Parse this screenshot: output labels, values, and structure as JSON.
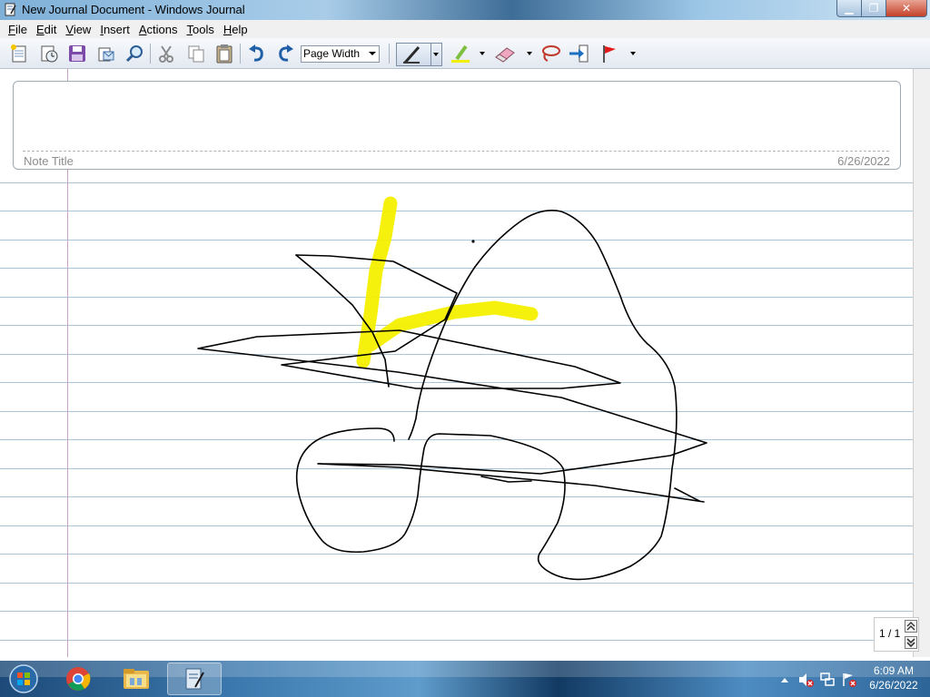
{
  "window": {
    "title": "New Journal Document - Windows Journal",
    "controls": {
      "minimize": "▁",
      "maximize": "❐",
      "close": "✕"
    }
  },
  "menu": [
    {
      "key": "F",
      "rest": "ile"
    },
    {
      "key": "E",
      "rest": "dit"
    },
    {
      "key": "V",
      "rest": "iew"
    },
    {
      "key": "I",
      "rest": "nsert"
    },
    {
      "key": "A",
      "rest": "ctions"
    },
    {
      "key": "T",
      "rest": "ools"
    },
    {
      "key": "H",
      "rest": "elp"
    }
  ],
  "toolbar": {
    "zoom_value": "Page Width",
    "icons": [
      "new-note-icon",
      "templates-icon",
      "save-icon",
      "send-icon",
      "find-icon",
      "cut-icon",
      "copy-icon",
      "paste-icon",
      "undo-icon",
      "redo-icon",
      "pen-icon",
      "highlighter-icon",
      "eraser-icon",
      "lasso-icon",
      "insert-space-icon",
      "flag-icon"
    ],
    "highlight_color": "#f2ee00",
    "flag_color": "#e21b1b"
  },
  "note": {
    "title_placeholder": "Note Title",
    "date": "6/26/2022"
  },
  "page_nav": {
    "indicator": "1 / 1"
  },
  "taskbar": {
    "apps": [
      "start-orb",
      "chrome",
      "windows-explorer",
      "windows-journal"
    ],
    "clock_time": "6:09 AM",
    "clock_date": "6/26/2022"
  },
  "ink_colors": {
    "pen": "#000000",
    "highlighter": "#f4f000"
  }
}
